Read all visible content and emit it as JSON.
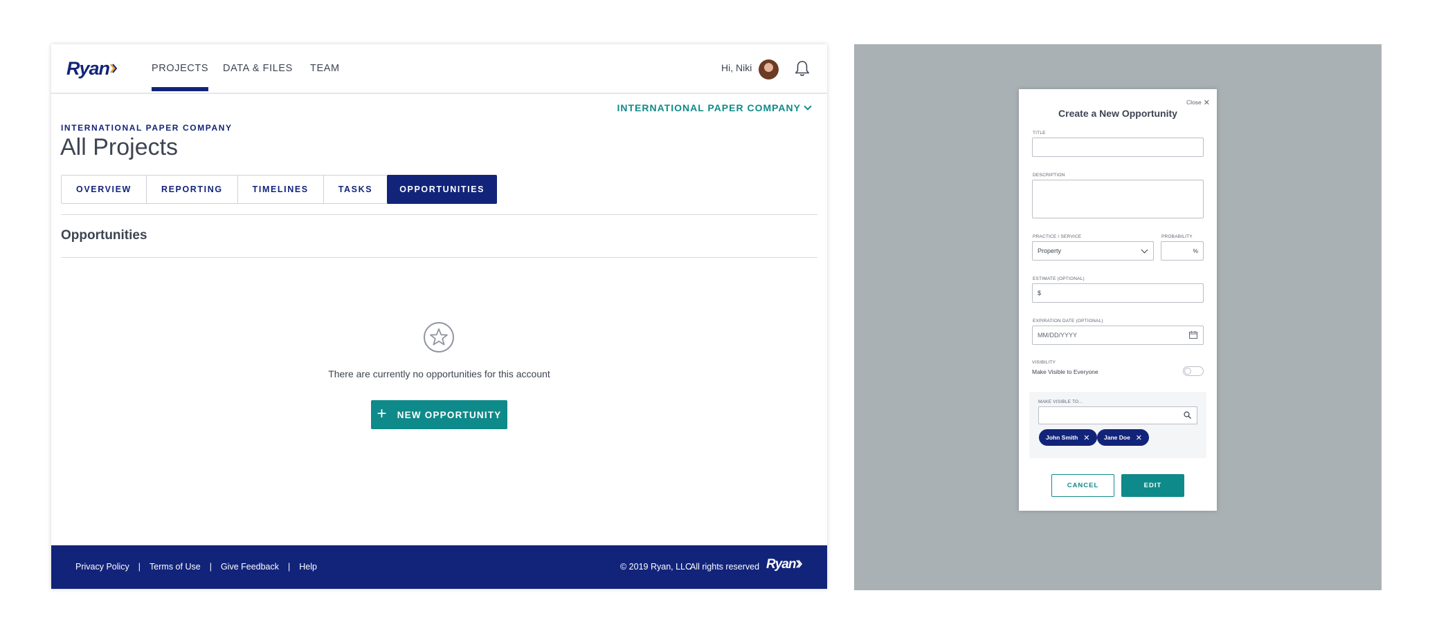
{
  "header": {
    "logo": "Ryan",
    "nav": [
      {
        "label": "PROJECTS",
        "active": true
      },
      {
        "label": "DATA & FILES",
        "active": false
      },
      {
        "label": "TEAM",
        "active": false
      }
    ],
    "greeting": "Hi, Niki",
    "icons": {
      "avatar": "user-avatar",
      "notifications": "bell-icon"
    }
  },
  "company_selector": "INTERNATIONAL PAPER COMPANY",
  "company_label": "INTERNATIONAL PAPER COMPANY",
  "page_title": "All Projects",
  "tabs": [
    "OVERVIEW",
    "REPORTING",
    "TIMELINES",
    "TASKS",
    "OPPORTUNITIES"
  ],
  "active_tab": "OPPORTUNITIES",
  "section_title": "Opportunities",
  "empty_state": {
    "icon": "star-icon",
    "message": "There are currently no opportunities for this account",
    "button_label": "NEW OPPORTUNITY"
  },
  "footer": {
    "links": [
      "Privacy Policy",
      "Terms of Use",
      "Give Feedback",
      "Help"
    ],
    "copyright": "© 2019 Ryan, LLC",
    "rights": "All rights reserved",
    "logo": "Ryan"
  },
  "modal": {
    "close_label": "Close",
    "title": "Create a New Opportunity",
    "fields": {
      "title_label": "TITLE",
      "title_value": "",
      "description_label": "DESCRIPTION",
      "description_value": "",
      "practice_label": "PRACTICE / SERVICE",
      "practice_value": "Property",
      "probability_label": "PROBABILITY",
      "probability_suffix": "%",
      "estimate_label": "ESTIMATE (OPTIONAL)",
      "estimate_prefix": "$",
      "expiration_label": "EXPIRATION DATE (OPTIONAL)",
      "expiration_placeholder": "MM/DD/YYYY",
      "visibility_label": "VISIBILITY",
      "visibility_text": "Make Visible to Everyone",
      "visibility_on": false,
      "visible_to_label": "MAKE VISIBLE TO...",
      "visible_to_value": ""
    },
    "chips": [
      "John Smith",
      "Jane Doe"
    ],
    "cancel_label": "CANCEL",
    "edit_label": "EDIT"
  },
  "colors": {
    "brand_navy": "#12247a",
    "teal": "#0f8a8a",
    "text": "#3d4452",
    "overlay": "#a9b1b4"
  }
}
